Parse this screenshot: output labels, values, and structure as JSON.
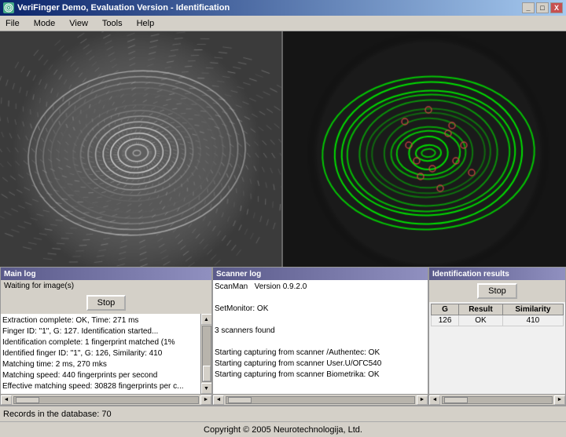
{
  "window": {
    "title": "VeriFinger Demo, Evaluation Version - Identification",
    "icon": "fingerprint-icon"
  },
  "titlebar": {
    "minimize_label": "_",
    "maximize_label": "□",
    "close_label": "X"
  },
  "menu": {
    "items": [
      "File",
      "Mode",
      "View",
      "Tools",
      "Help"
    ]
  },
  "panels": {
    "main_log": {
      "title": "Main log",
      "stop_label": "Stop",
      "waiting_text": "Waiting for image(s)",
      "log_text": "Extraction complete: OK, Time: 271 ms\nFinger ID: \"1\", G: 127. Identification started...\nIdentification complete: 1 fingerprint matched (1%\nIdentified finger ID: \"1\", G: 126, Similarity: 410\nMatching time: 2 ms, 270 mks\nMatching speed: 440 fingerprints per second\nEffective matching speed: 30828 fingerprints per c..."
    },
    "scanner_log": {
      "title": "Scanner log",
      "log_text": "ScanMan   Version 0.9.2.0\n\nSetMonitor: OK\n\n3 scanners found\n\nStarting capturing from scanner /Authentec: OK\nStarting capturing from scanner User.U/ОГС540\nStarting capturing from scanner Biometrika: OK"
    },
    "identification": {
      "title": "Identification results",
      "stop_label": "Stop",
      "table": {
        "headers": [
          "G",
          "Result",
          "Similarity"
        ],
        "rows": [
          {
            "g": "126",
            "result": "OK",
            "similarity": "410"
          }
        ]
      }
    }
  },
  "status_bar": {
    "text": "Records in the database: 70"
  },
  "copyright": {
    "text": "Copyright © 2005 Neurotechnologija, Ltd."
  },
  "colors": {
    "title_gradient_start": "#0a246a",
    "title_gradient_end": "#a6caf0",
    "panel_title": "#5a5a8a",
    "green_ridges": "#00cc00",
    "accent": "#0a246a"
  }
}
